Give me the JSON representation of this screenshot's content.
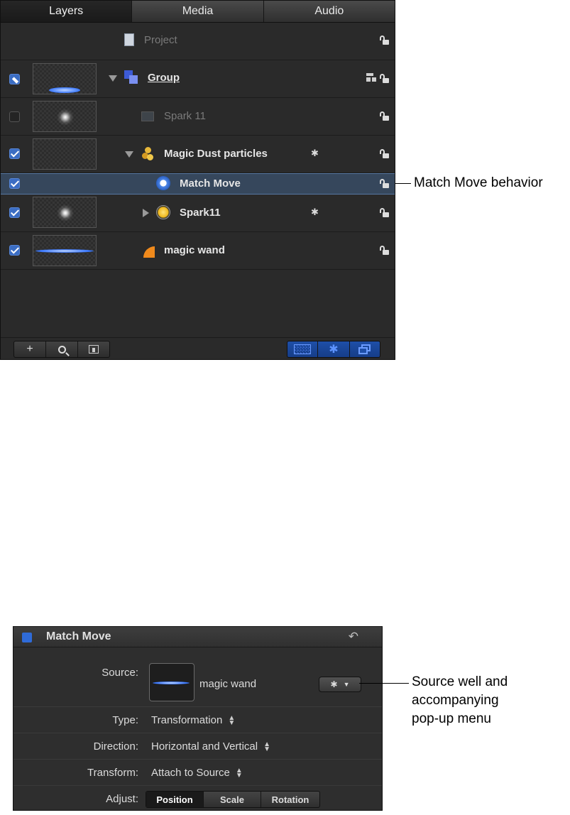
{
  "tabs": [
    "Layers",
    "Media",
    "Audio"
  ],
  "project_label": "Project",
  "layers": [
    {
      "label": "Group"
    },
    {
      "label": "Spark 11"
    },
    {
      "label": "Magic Dust particles"
    },
    {
      "label": "Match Move"
    },
    {
      "label": "Spark11"
    },
    {
      "label": "magic wand"
    }
  ],
  "bottom_bar": {
    "add": "+",
    "search": "search-icon",
    "library": "library-icon"
  },
  "annotations": {
    "match_move": "Match Move behavior",
    "source_well_line1": "Source well and",
    "source_well_line2": "accompanying",
    "source_well_line3": "pop-up menu"
  },
  "inspector": {
    "title": "Match Move",
    "source_label": "Source:",
    "source_value": "magic wand",
    "type_label": "Type:",
    "type_value": "Transformation",
    "direction_label": "Direction:",
    "direction_value": "Horizontal and Vertical",
    "transform_label": "Transform:",
    "transform_value": "Attach to Source",
    "adjust_label": "Adjust:",
    "adjust_options": [
      "Position",
      "Scale",
      "Rotation"
    ],
    "adjust_selected": "Position"
  },
  "colors": {
    "selection": "#36475c",
    "accent": "#3b6dc3"
  }
}
